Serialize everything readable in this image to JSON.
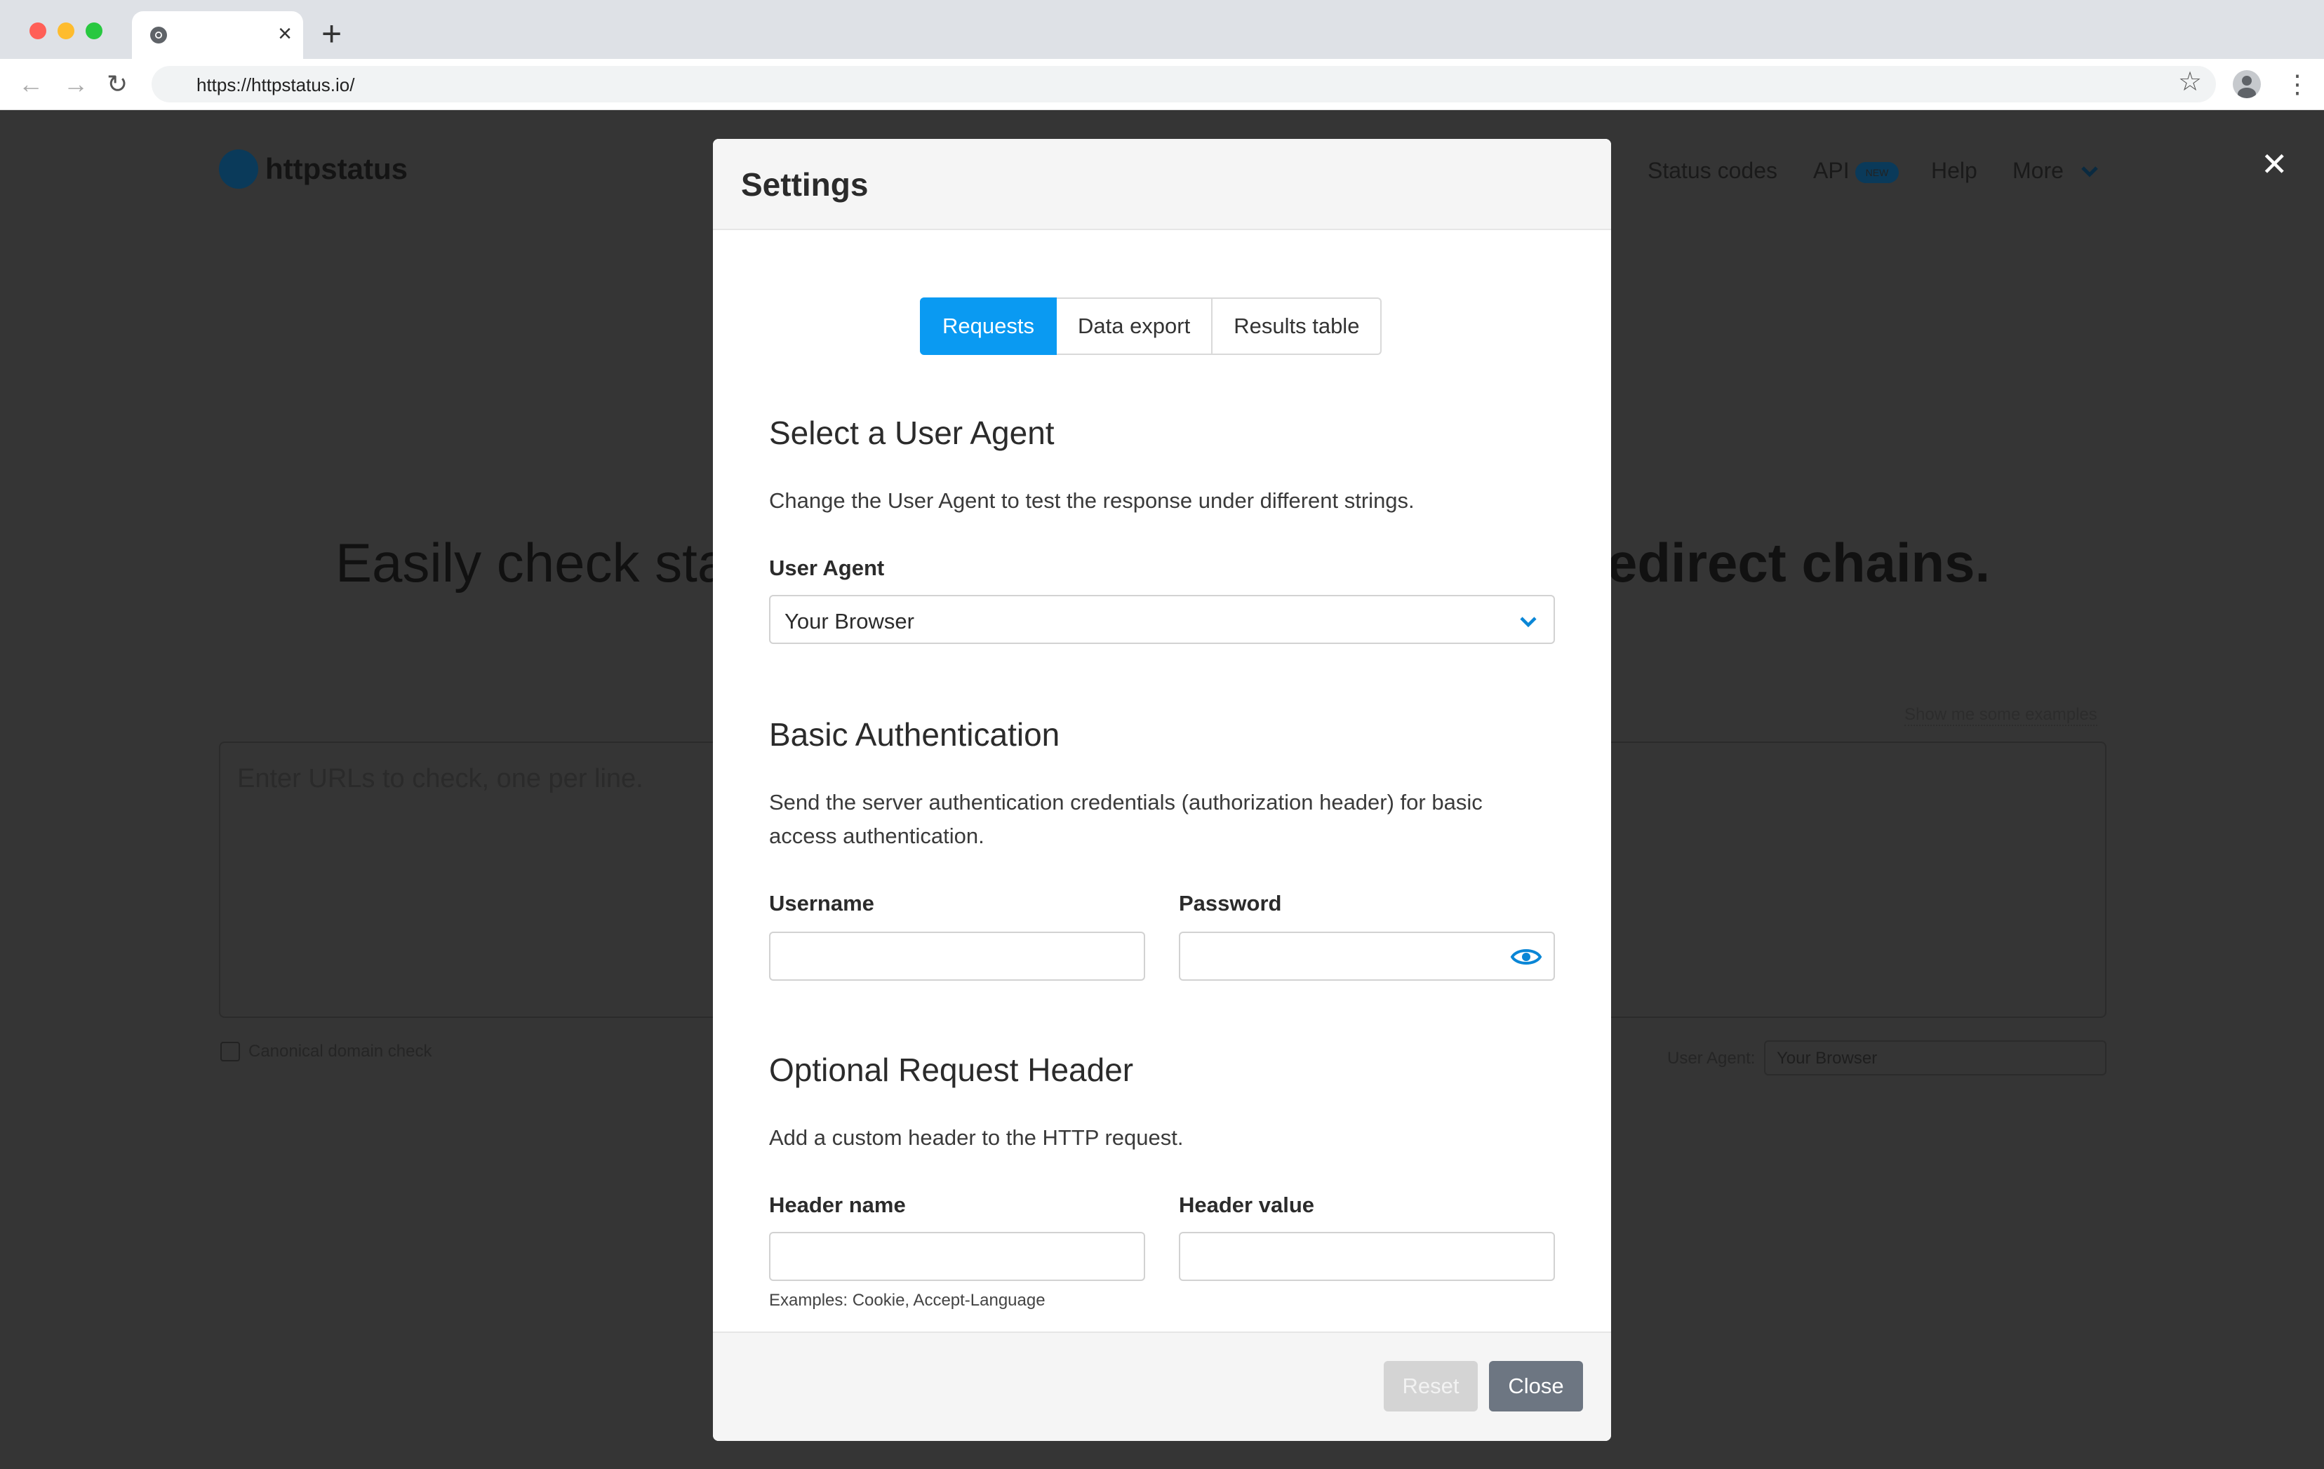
{
  "browser": {
    "url": "https://httpstatus.io/",
    "tab_close": "×",
    "new_tab": "+"
  },
  "page": {
    "logo_text": "httpstatus",
    "nav": {
      "status_codes": "Status codes",
      "api": "API",
      "api_badge": "NEW",
      "help": "Help",
      "more": "More"
    },
    "hero_left": "Easily check sta",
    "hero_right": "edirect chains.",
    "textarea_placeholder": "Enter URLs to check, one per line.",
    "examples_link": "Show me some examples",
    "canonical_label": "Canonical domain check",
    "user_agent_label": "User Agent:",
    "user_agent_value": "Your Browser"
  },
  "modal": {
    "title": "Settings",
    "tabs": [
      {
        "label": "Requests",
        "active": true
      },
      {
        "label": "Data export",
        "active": false
      },
      {
        "label": "Results table",
        "active": false
      }
    ],
    "user_agent": {
      "title": "Select a User Agent",
      "description": "Change the User Agent to test the response under different strings.",
      "label": "User Agent",
      "value": "Your Browser"
    },
    "basic_auth": {
      "title": "Basic Authentication",
      "description": "Send the server authentication credentials (authorization header) for basic access authentication.",
      "username_label": "Username",
      "password_label": "Password",
      "username_value": "",
      "password_value": ""
    },
    "request_header": {
      "title": "Optional Request Header",
      "description": "Add a custom header to the HTTP request.",
      "name_label": "Header name",
      "value_label": "Header value",
      "hint": "Examples: Cookie, Accept-Language"
    },
    "footer": {
      "reset": "Reset",
      "close": "Close"
    }
  },
  "colors": {
    "accent": "#0a9af2",
    "overlay": "#353535",
    "close_button": "#6d7682"
  }
}
